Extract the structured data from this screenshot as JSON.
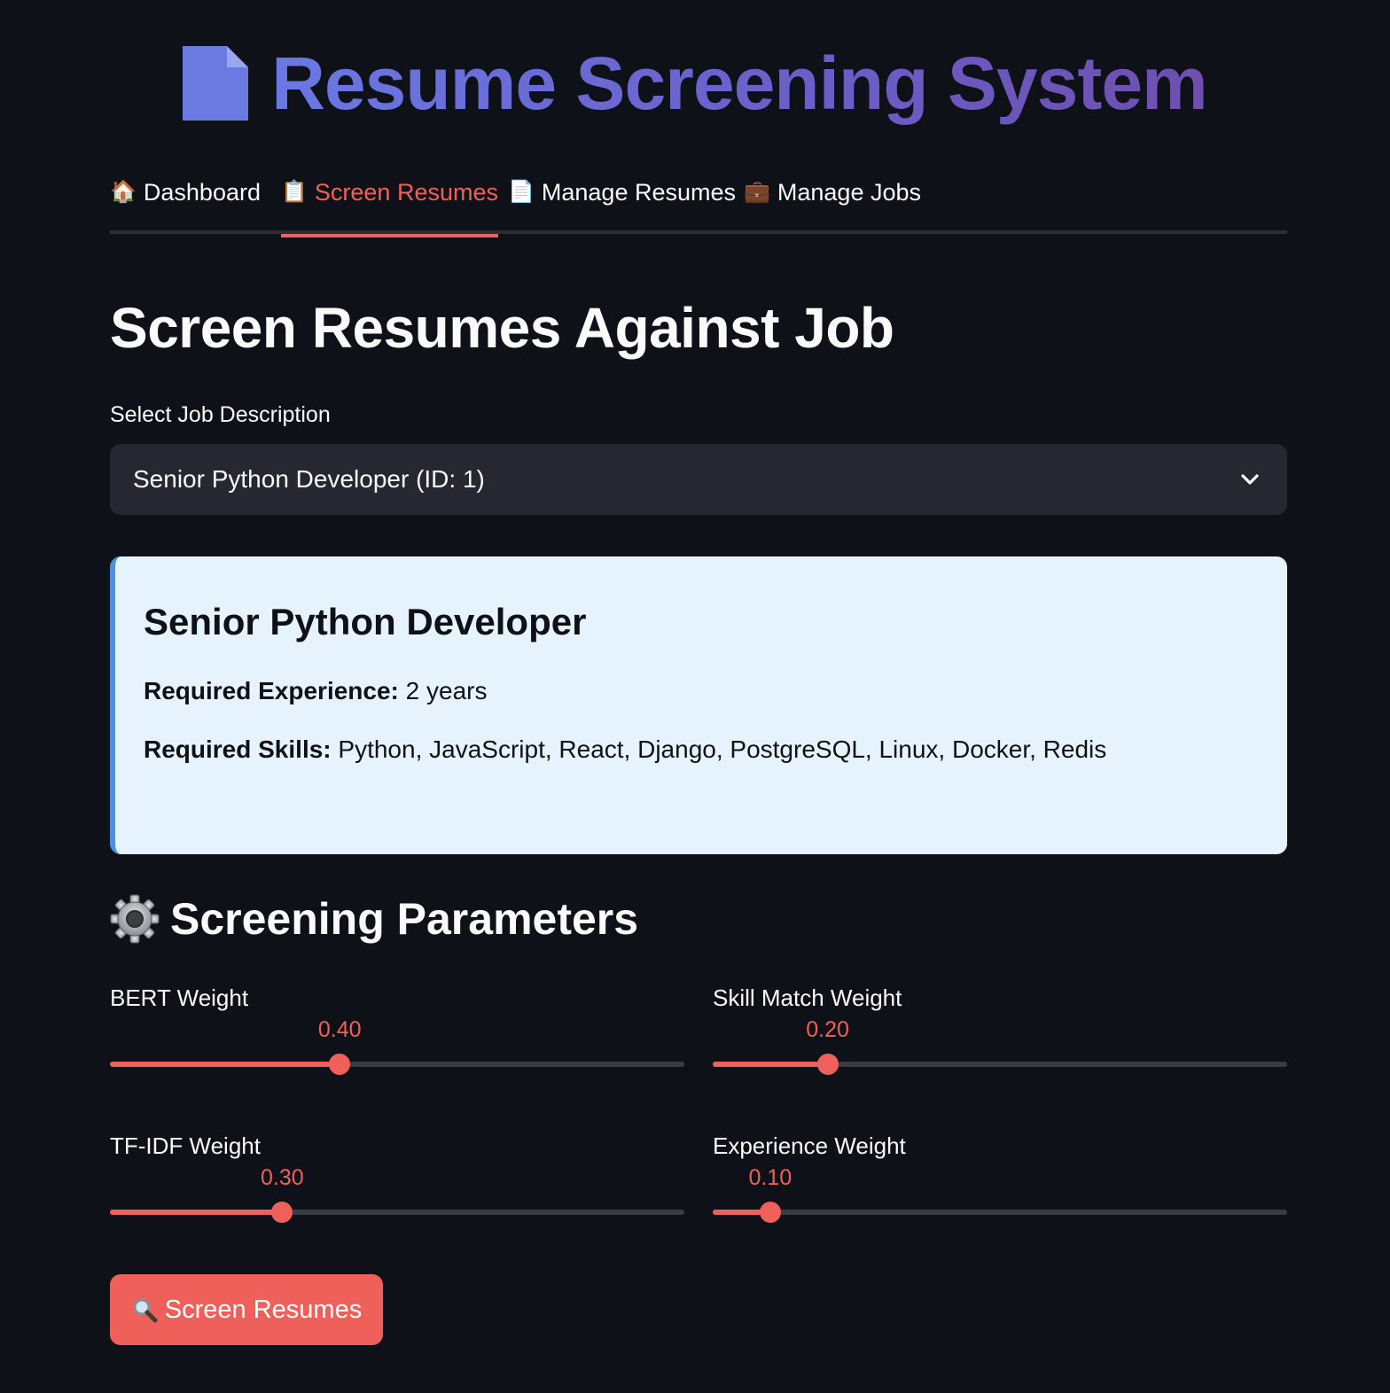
{
  "app": {
    "title": "Resume Screening System",
    "title_icon": "document-icon"
  },
  "tabs": [
    {
      "label": "Dashboard",
      "icon": "🏠",
      "active": false
    },
    {
      "label": "Screen Resumes",
      "icon": "📋",
      "active": true
    },
    {
      "label": "Manage Resumes",
      "icon": "📄",
      "active": false
    },
    {
      "label": "Manage Jobs",
      "icon": "💼",
      "active": false
    }
  ],
  "page": {
    "heading": "Screen Resumes Against Job"
  },
  "job_select": {
    "label": "Select Job Description",
    "value": "Senior Python Developer (ID: 1)"
  },
  "job_card": {
    "title": "Senior Python Developer",
    "experience_label": "Required Experience:",
    "experience_value": "2 years",
    "skills_label": "Required Skills:",
    "skills_value": "Python, JavaScript, React, Django, PostgreSQL, Linux, Docker, Redis"
  },
  "params": {
    "heading": "Screening Parameters",
    "icon": "gear-icon",
    "sliders": [
      {
        "label": "BERT Weight",
        "value": 0.4,
        "display": "0.40",
        "min": 0,
        "max": 1
      },
      {
        "label": "Skill Match Weight",
        "value": 0.2,
        "display": "0.20",
        "min": 0,
        "max": 1
      },
      {
        "label": "TF-IDF Weight",
        "value": 0.3,
        "display": "0.30",
        "min": 0,
        "max": 1
      },
      {
        "label": "Experience Weight",
        "value": 0.1,
        "display": "0.10",
        "min": 0,
        "max": 1
      }
    ]
  },
  "actions": {
    "screen_label": "Screen Resumes",
    "screen_icon": "search-icon"
  },
  "colors": {
    "background": "#0e1117",
    "accent": "#f0605a",
    "card_background": "#e6f2fc",
    "card_border": "#4a90e2",
    "title_gradient_start": "#6a78e3",
    "title_gradient_end": "#6e4fae"
  }
}
